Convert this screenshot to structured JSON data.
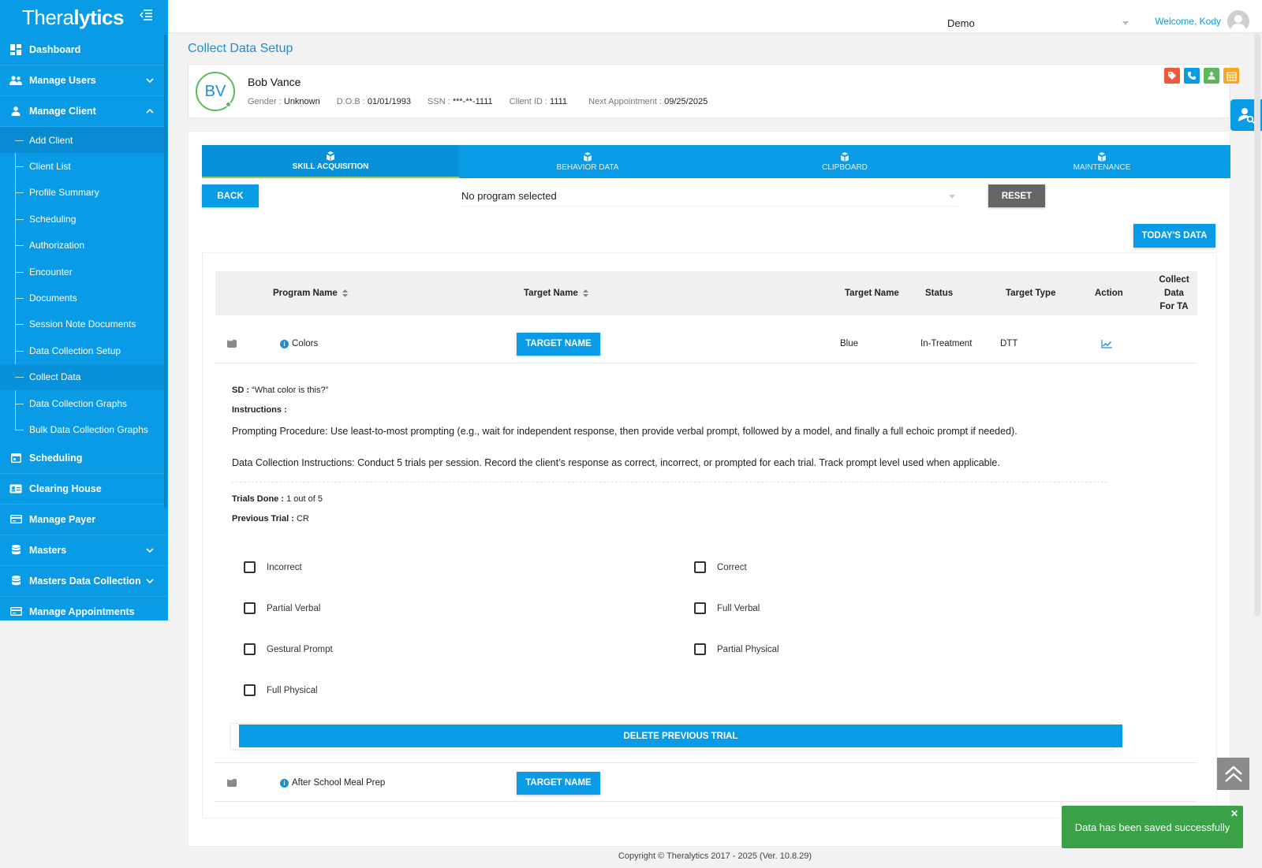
{
  "brand": {
    "logo_light": "Thera",
    "logo_bold": "lytics"
  },
  "sidebar": {
    "items": [
      {
        "label": "Dashboard"
      },
      {
        "label": "Manage Users"
      },
      {
        "label": "Manage Client"
      }
    ],
    "client_sub": [
      {
        "label": "Add Client"
      },
      {
        "label": "Client List"
      },
      {
        "label": "Profile Summary"
      },
      {
        "label": "Scheduling"
      },
      {
        "label": "Authorization"
      },
      {
        "label": "Encounter"
      },
      {
        "label": "Documents"
      },
      {
        "label": "Session Note Documents"
      },
      {
        "label": "Data Collection Setup"
      },
      {
        "label": "Collect Data"
      },
      {
        "label": "Data Collection Graphs"
      },
      {
        "label": "Bulk Data Collection Graphs"
      }
    ],
    "bottom_items": [
      {
        "label": "Scheduling"
      },
      {
        "label": "Clearing House"
      },
      {
        "label": "Manage Payer"
      },
      {
        "label": "Masters"
      },
      {
        "label": "Masters Data Collection"
      },
      {
        "label": "Manage Appointments"
      }
    ]
  },
  "topbar": {
    "org": "Demo",
    "welcome": "Welcome, Kody"
  },
  "page_title": "Collect Data Setup",
  "client": {
    "initials": "BV",
    "name": "Bob Vance",
    "gender_label": "Gender :",
    "gender": "Unknown",
    "dob_label": "D.O.B :",
    "dob": "01/01/1993",
    "ssn_label": "SSN :",
    "ssn": "***-**-1111",
    "client_id_label": "Client ID :",
    "client_id": "1111",
    "next_appt_label": "Next Appointment :",
    "next_appt": "09/25/2025"
  },
  "tabs": [
    {
      "label": "SKILL ACQUISITION"
    },
    {
      "label": "BEHAVIOR DATA"
    },
    {
      "label": "CLIPBOARD"
    },
    {
      "label": "MAINTENANCE"
    }
  ],
  "controls": {
    "back": "BACK",
    "program_select": "No program selected",
    "reset": "RESET",
    "todays_data": "TODAY'S DATA"
  },
  "table": {
    "headers": {
      "program_name": "Program Name",
      "target_name": "Target Name",
      "target_name2": "Target Name",
      "status": "Status",
      "target_type": "Target Type",
      "action": "Action",
      "collect_line1": "Collect Data",
      "collect_line2": "For TA"
    },
    "rows": [
      {
        "program": "Colors",
        "button": "TARGET NAME",
        "target": "Blue",
        "status": "In-Treatment",
        "type": "DTT"
      },
      {
        "program": "After School Meal Prep",
        "button": "TARGET NAME"
      }
    ]
  },
  "detail": {
    "sd_label": "SD :",
    "sd": "“What color is this?”",
    "instructions_label": "Instructions :",
    "prompting": "Prompting Procedure: Use least-to-most prompting (e.g., wait for independent response, then provide verbal prompt, followed by a model, and finally a full echoic prompt if needed).",
    "data_instr": "Data Collection Instructions: Conduct 5 trials per session. Record the client’s response as correct, incorrect, or prompted for each trial. Track prompt level used when applicable.",
    "trials_label": "Trials Done :",
    "trials": "1 out of 5",
    "prev_label": "Previous Trial :",
    "prev": "CR",
    "options_left": [
      "Incorrect",
      "Partial Verbal",
      "Gestural Prompt",
      "Full Physical"
    ],
    "options_right": [
      "Correct",
      "Full Verbal",
      "Partial Physical"
    ],
    "delete_btn": "DELETE PREVIOUS TRIAL"
  },
  "footer": "Copyright © Theralytics 2017 - 2025 (Ver. 10.8.29)",
  "toast": {
    "message": "Data has been saved successfully"
  },
  "colors": {
    "primary": "#0a9be6",
    "success": "#3aa147",
    "gray_button": "#666666"
  }
}
